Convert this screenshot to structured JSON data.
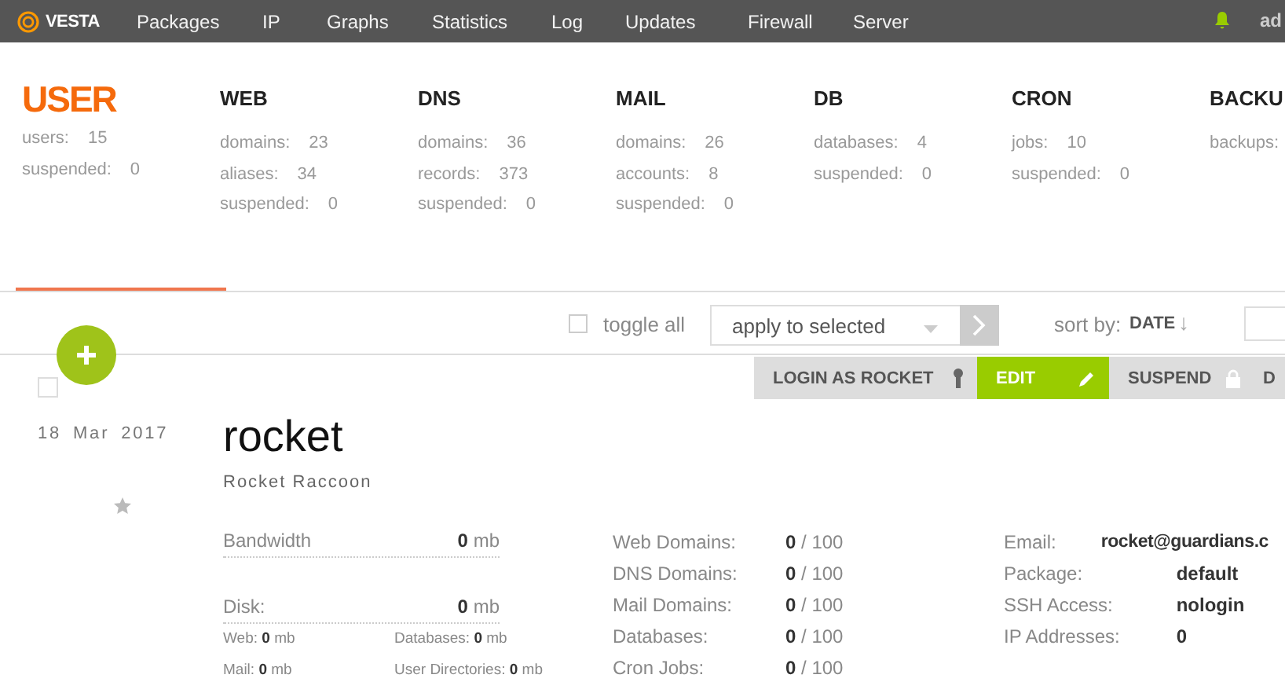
{
  "topbar": {
    "logo": "VESTA",
    "nav": [
      {
        "label": "Packages"
      },
      {
        "label": "IP"
      },
      {
        "label": "Graphs"
      },
      {
        "label": "Statistics"
      },
      {
        "label": "Log"
      },
      {
        "label": "Updates"
      },
      {
        "label": "Firewall"
      },
      {
        "label": "Server"
      }
    ],
    "user": "ad"
  },
  "stats": [
    {
      "title": "USER",
      "selected": true,
      "rows": [
        {
          "label": "users:",
          "value": "15"
        },
        {
          "label": "suspended:",
          "value": "0"
        }
      ]
    },
    {
      "title": "WEB",
      "selected": false,
      "rows": [
        {
          "label": "domains:",
          "value": "23"
        },
        {
          "label": "aliases:",
          "value": "34"
        },
        {
          "label": "suspended:",
          "value": "0"
        }
      ]
    },
    {
      "title": "DNS",
      "selected": false,
      "rows": [
        {
          "label": "domains:",
          "value": "36"
        },
        {
          "label": "records:",
          "value": "373"
        },
        {
          "label": "suspended:",
          "value": "0"
        }
      ]
    },
    {
      "title": "MAIL",
      "selected": false,
      "rows": [
        {
          "label": "domains:",
          "value": "26"
        },
        {
          "label": "accounts:",
          "value": "8"
        },
        {
          "label": "suspended:",
          "value": "0"
        }
      ]
    },
    {
      "title": "DB",
      "selected": false,
      "rows": [
        {
          "label": "databases:",
          "value": "4"
        },
        {
          "label": "suspended:",
          "value": "0"
        }
      ]
    },
    {
      "title": "CRON",
      "selected": false,
      "rows": [
        {
          "label": "jobs:",
          "value": "10"
        },
        {
          "label": "suspended:",
          "value": "0"
        }
      ]
    },
    {
      "title": "BACKU",
      "selected": false,
      "rows": [
        {
          "label": "backups:"
        }
      ]
    }
  ],
  "toolbar": {
    "toggle_all": {
      "label": "toggle all",
      "checked": false
    },
    "bulk_action": {
      "value": "apply to selected"
    },
    "sort": {
      "label": "sort by:",
      "value": "DATE",
      "arrow": "↓"
    }
  },
  "actions": [
    {
      "label": "LOGIN AS ROCKET",
      "kind": "key",
      "active": false
    },
    {
      "label": "EDIT",
      "kind": "pencil",
      "active": true
    },
    {
      "label": "SUSPEND",
      "kind": "lock",
      "active": false
    },
    {
      "label": "D",
      "kind": "none",
      "active": false
    }
  ],
  "record": {
    "checked": false,
    "date": "18 Mar 2017",
    "name": "rocket",
    "full_name": "Rocket Raccoon",
    "starred": false,
    "usage": [
      {
        "label": "Bandwidth",
        "value": "**0** mb"
      },
      {
        "label": "Disk:",
        "value": "**0** mb"
      }
    ],
    "disk_parts": [
      {
        "label": "Web:",
        "value": "**0** mb"
      },
      {
        "label": "Databases:",
        "value": "**0** mb"
      },
      {
        "label": "Mail:",
        "value": "**0** mb"
      },
      {
        "label": "User Directories:",
        "value": "**0** mb"
      }
    ],
    "limits": [
      {
        "label": "Web Domains:",
        "value": "**0** / 100"
      },
      {
        "label": "DNS Domains:",
        "value": "**0** / 100"
      },
      {
        "label": "Mail Domains:",
        "value": "**0** / 100"
      },
      {
        "label": "Databases:",
        "value": "**0** / 100"
      },
      {
        "label": "Cron Jobs:",
        "value": "**0** / 100"
      }
    ],
    "info": [
      {
        "label": "Email:",
        "value": "rocket@guardians.c"
      },
      {
        "label": "Package:",
        "value": "default"
      },
      {
        "label": "SSH Access:",
        "value": "nologin"
      },
      {
        "label": "IP Addresses:",
        "value": "0"
      }
    ]
  }
}
